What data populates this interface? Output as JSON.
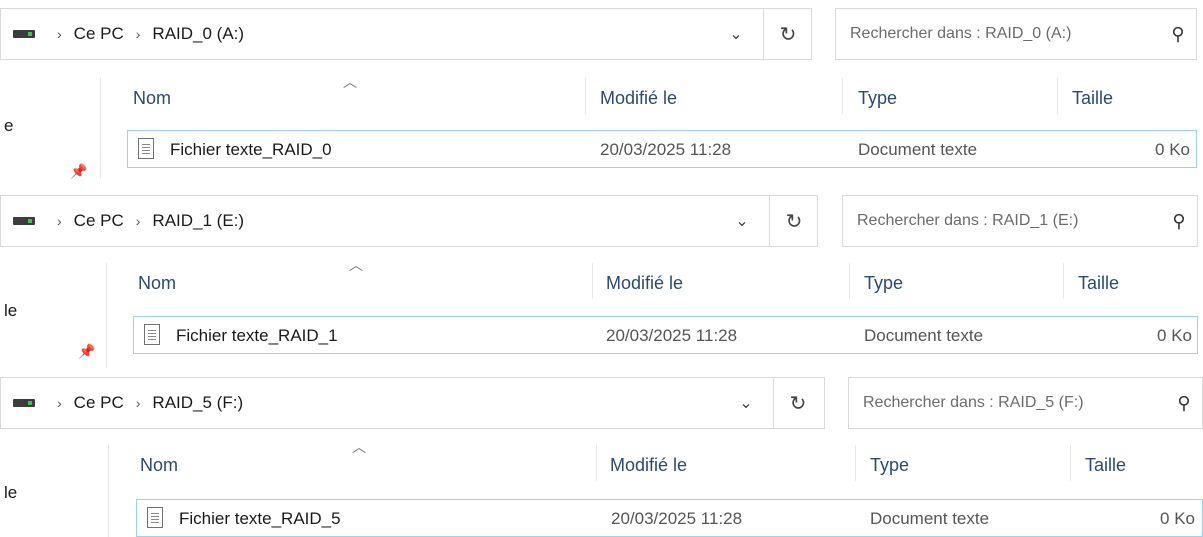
{
  "panels": [
    {
      "breadcrumb": [
        "Ce PC",
        "RAID_0 (A:)"
      ],
      "search_placeholder": "Rechercher dans : RAID_0 (A:)",
      "left_fragment": "e",
      "columns": [
        "Nom",
        "Modifié le",
        "Type",
        "Taille"
      ],
      "file": {
        "name": "Fichier texte_RAID_0",
        "modified": "20/03/2025 11:28",
        "type": "Document texte",
        "size": "0 Ko"
      }
    },
    {
      "breadcrumb": [
        "Ce PC",
        "RAID_1 (E:)"
      ],
      "search_placeholder": "Rechercher dans : RAID_1 (E:)",
      "left_fragment": "le",
      "columns": [
        "Nom",
        "Modifié le",
        "Type",
        "Taille"
      ],
      "file": {
        "name": "Fichier texte_RAID_1",
        "modified": "20/03/2025 11:28",
        "type": "Document texte",
        "size": "0 Ko"
      }
    },
    {
      "breadcrumb": [
        "Ce PC",
        "RAID_5 (F:)"
      ],
      "search_placeholder": "Rechercher dans : RAID_5 (F:)",
      "left_fragment": "le",
      "columns": [
        "Nom",
        "Modifié le",
        "Type",
        "Taille"
      ],
      "file": {
        "name": "Fichier texte_RAID_5",
        "modified": "20/03/2025 11:28",
        "type": "Document texte",
        "size": "0 Ko"
      }
    }
  ],
  "icons": {
    "drive": "drive-icon",
    "chevron": "chevron-right-icon",
    "dropdown": "chevron-down-icon",
    "refresh": "refresh-icon",
    "search": "search-icon",
    "pin": "pin-icon",
    "sort": "sort-up-icon",
    "file": "text-file-icon"
  }
}
